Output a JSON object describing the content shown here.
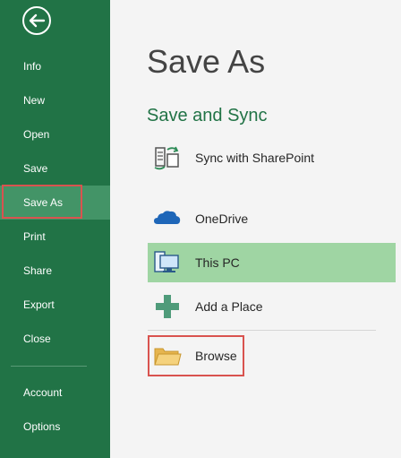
{
  "sidebar": {
    "back_icon": "back-arrow-icon",
    "items": [
      {
        "label": "Info"
      },
      {
        "label": "New"
      },
      {
        "label": "Open"
      },
      {
        "label": "Save"
      },
      {
        "label": "Save As",
        "active": true
      },
      {
        "label": "Print"
      },
      {
        "label": "Share"
      },
      {
        "label": "Export"
      },
      {
        "label": "Close"
      },
      {
        "label": "Account"
      },
      {
        "label": "Options"
      }
    ]
  },
  "main": {
    "title": "Save As",
    "section_title": "Save and Sync",
    "locations": [
      {
        "label": "Sync with SharePoint",
        "icon": "sync-sharepoint-icon"
      },
      {
        "label": "OneDrive",
        "icon": "onedrive-cloud-icon"
      },
      {
        "label": "This PC",
        "icon": "computer-icon",
        "selected": true
      },
      {
        "label": "Add a Place",
        "icon": "plus-icon"
      },
      {
        "label": "Browse",
        "icon": "folder-icon"
      }
    ]
  },
  "colors": {
    "sidebar_bg": "#217346",
    "sidebar_active": "#439467",
    "selected_bg": "#9fd5a3",
    "highlight_outline": "#d9534f",
    "accent_text": "#217346"
  }
}
